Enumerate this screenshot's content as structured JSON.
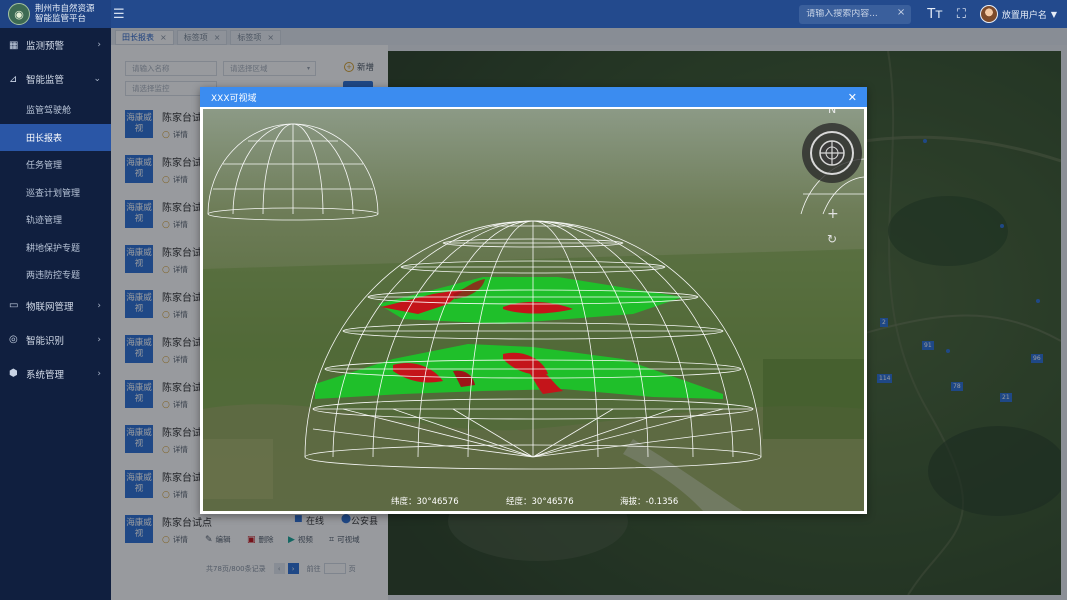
{
  "app": {
    "logo_glyph": "◉",
    "title_line1": "荆州市自然资源",
    "title_line2": "智能监管平台",
    "menu_toggle_glyph": "☰"
  },
  "header": {
    "search_placeholder": "请输入搜索内容...",
    "search_clear": "×",
    "font_btn": "Tт",
    "fullscreen_btn": "⛶",
    "user_name": "放置用户名",
    "user_caret": "▼"
  },
  "sidebar": {
    "items": [
      {
        "icon": "monitor-alert-icon",
        "glyph": "▦",
        "label": "监测预警",
        "arrow": "›"
      },
      {
        "icon": "chart-icon",
        "glyph": "⊿",
        "label": "智能监管",
        "arrow": "⌄"
      },
      {
        "icon": "iot-icon",
        "glyph": "▭",
        "label": "物联网管理",
        "arrow": "›"
      },
      {
        "icon": "ai-recognize-icon",
        "glyph": "◎",
        "label": "智能识别",
        "arrow": "›"
      },
      {
        "icon": "settings-icon",
        "glyph": "⬢",
        "label": "系统管理",
        "arrow": "›"
      }
    ],
    "sub_items": [
      "监管驾驶舱",
      "田长报表",
      "任务管理",
      "巡查计划管理",
      "轨迹管理",
      "耕地保护专题",
      "两违防控专题"
    ]
  },
  "tabs": [
    {
      "label": "田长报表",
      "close": "×"
    },
    {
      "label": "标签项",
      "close": "×"
    },
    {
      "label": "标签项",
      "close": "×"
    }
  ],
  "filters": {
    "name_placeholder": "请输入名称",
    "area_placeholder": "请选择区域",
    "status_placeholder": "请选择监控",
    "dropdown_glyph": "▾",
    "add_label": "新增",
    "add_glyph": "+"
  },
  "list": {
    "thumb_text": "海康威视",
    "visible_rows": [
      {
        "name": "陈家台试"
      },
      {
        "name": "陈家台试"
      },
      {
        "name": "陈家台试"
      },
      {
        "name": "陈家台试"
      },
      {
        "name": "陈家台试"
      },
      {
        "name": "陈家台试"
      },
      {
        "name": "陈家台试"
      },
      {
        "name": "陈家台试"
      },
      {
        "name": "陈家台试"
      }
    ],
    "last_row": {
      "name": "陈家台试点",
      "status": "在线",
      "org": "公安县",
      "detail": "详情",
      "edit": "编辑",
      "delete": "删除",
      "video": "视频",
      "viewshed": "可视域"
    },
    "detail_label": "详情",
    "pager": {
      "summary": "共78页/800条记录",
      "prev": "‹",
      "next": "›",
      "goto": "前往",
      "page_unit": "页"
    }
  },
  "map": {
    "labels": [
      "114",
      "91",
      "96",
      "78",
      "21",
      "2"
    ]
  },
  "modal": {
    "title": "XXX可视域",
    "close": "✕",
    "compass_label": "N",
    "zoom_in": "+",
    "reset": "↻",
    "readout": {
      "lat": "纬度：30°46576",
      "lon": "经度：30°46576",
      "alt": "海拔：-0.1356"
    }
  },
  "colors": {
    "topbar": "#234a8d",
    "sidebar": "#101f3f",
    "active": "#2a56a6",
    "modal_head": "#3b8cf0",
    "visible": "#1fbf2a",
    "hidden": "#c4141a"
  }
}
